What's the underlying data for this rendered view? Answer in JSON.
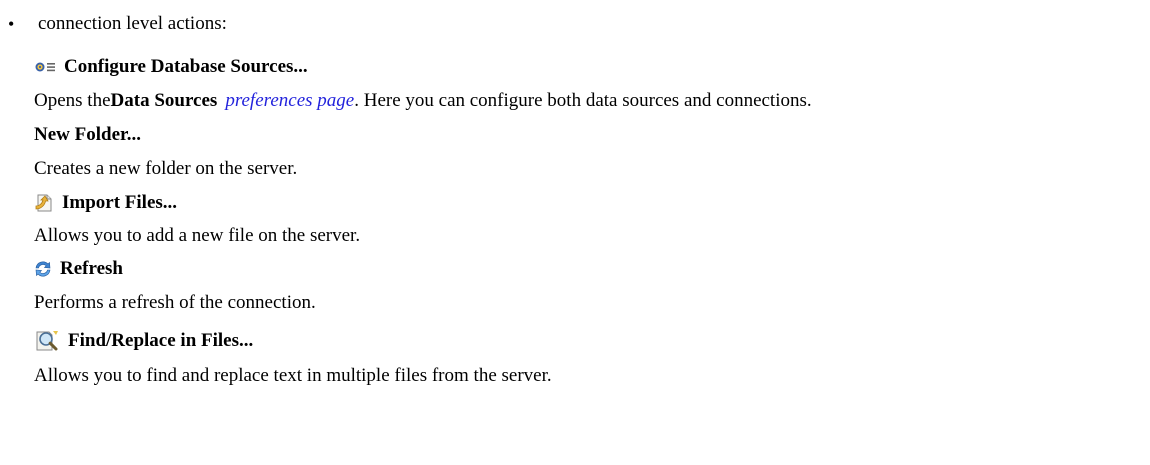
{
  "intro": {
    "bullet": "•",
    "text": "connection level actions:"
  },
  "actions": [
    {
      "icon": "configure-database-sources-icon",
      "title": "Configure Database Sources...",
      "desc_pre": "Opens the ",
      "desc_bold": "Data Sources",
      "desc_link": "preferences page",
      "desc_post": ". Here you can configure both data sources and connections."
    },
    {
      "title": "New Folder...",
      "desc": "Creates a new folder on the server."
    },
    {
      "icon": "import-files-icon",
      "title": "Import Files...",
      "desc": "Allows you to add a new file on the server."
    },
    {
      "icon": "refresh-icon",
      "title": "Refresh",
      "desc": "Performs a refresh of the connection."
    },
    {
      "icon": "find-replace-icon",
      "title": "Find/Replace in Files...",
      "desc": "Allows you to find and replace text in multiple files from the server."
    }
  ]
}
